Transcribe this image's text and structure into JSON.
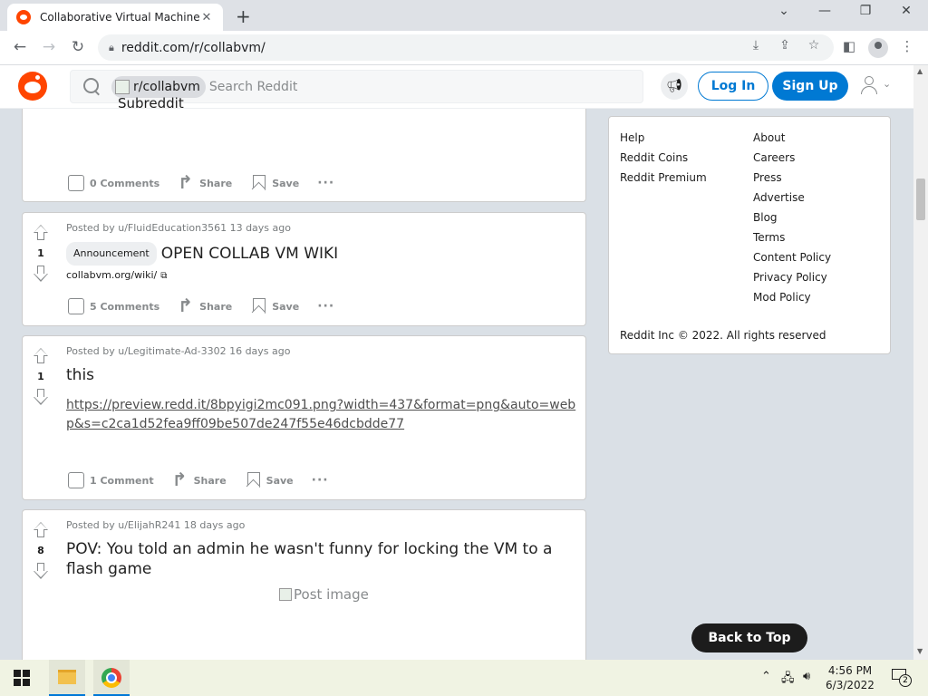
{
  "browser": {
    "tab_title": "Collaborative Virtual Machines!",
    "tab_close": "✕",
    "new_tab": "+",
    "url": "reddit.com/r/collabvm/",
    "window_controls": [
      "⌄",
      "—",
      "❐",
      "✕"
    ]
  },
  "header": {
    "community_chip": "r/collabvm",
    "community_icon_alt": "Subreddit Icon",
    "search_placeholder": "Search Reddit",
    "login_label": "Log In",
    "signup_label": "Sign Up"
  },
  "top_post": {
    "comments": "0 Comments",
    "share": "Share",
    "save": "Save",
    "more": "···"
  },
  "posts": [
    {
      "score": "1",
      "meta": "Posted by u/FluidEducation3561 13 days ago",
      "flair": "Announcement",
      "title": "OPEN COLLAB VM WIKI",
      "domain": "collabvm.org/wiki/",
      "comments": "5 Comments",
      "share": "Share",
      "save": "Save",
      "more": "···"
    },
    {
      "score": "1",
      "meta": "Posted by u/Legitimate-Ad-3302 16 days ago",
      "title": "this",
      "link": "https://preview.redd.it/8bpyigi2mc091.png?width=437&format=png&auto=webp&s=c2ca1d52fea9ff09be507de247f55e46dcbdde77",
      "comments": "1 Comment",
      "share": "Share",
      "save": "Save",
      "more": "···"
    },
    {
      "score": "8",
      "meta": "Posted by u/ElijahR241 18 days ago",
      "title": "POV: You told an admin he wasn't funny for locking the VM to a flash game",
      "image_alt": "Post image"
    }
  ],
  "sidebar": {
    "col1": [
      "Help",
      "Reddit Coins",
      "Reddit Premium"
    ],
    "col2": [
      "About",
      "Careers",
      "Press",
      "Advertise",
      "Blog",
      "Terms",
      "Content Policy",
      "Privacy Policy",
      "Mod Policy"
    ],
    "copyright": "Reddit Inc © 2022. All rights reserved"
  },
  "back_to_top": "Back to Top",
  "taskbar": {
    "time": "4:56 PM",
    "date": "6/3/2022",
    "notification_count": "2"
  },
  "colors": {
    "reddit_orange": "#ff4500",
    "reddit_blue": "#0079d3",
    "page_bg": "#dae0e6"
  }
}
